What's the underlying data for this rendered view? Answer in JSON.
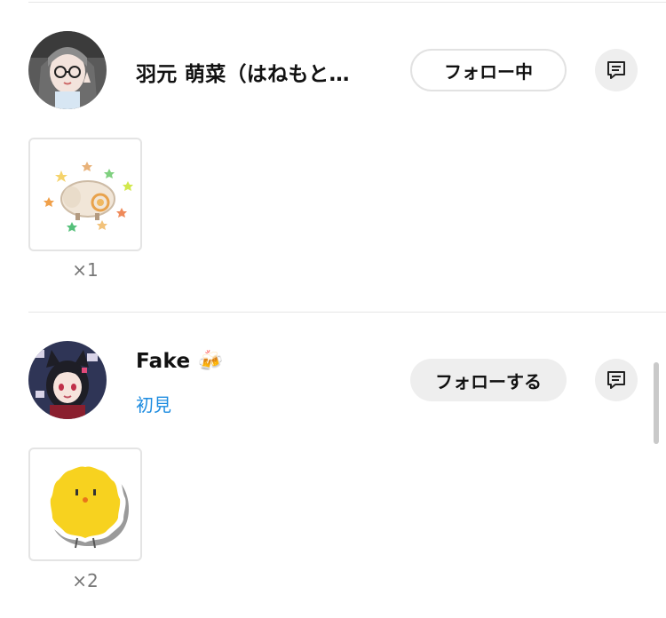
{
  "entries": [
    {
      "name": "羽元 萌菜（はねもと…",
      "tag": "",
      "follow_label": "フォロー中",
      "gift_count": "×1",
      "avatar_icon": "user-avatar-glasses-girl",
      "gift_icon": "sheep-sticker-icon"
    },
    {
      "name": "Fake",
      "name_emoji": "🍻",
      "tag": "初見",
      "follow_label": "フォローする",
      "gift_count": "×2",
      "avatar_icon": "user-avatar-catear-girl",
      "gift_icon": "yellow-chick-sticker-icon"
    }
  ],
  "colors": {
    "link": "#1d8ce0",
    "button_gray": "#eeeeee",
    "divider": "#e6e6e6"
  }
}
